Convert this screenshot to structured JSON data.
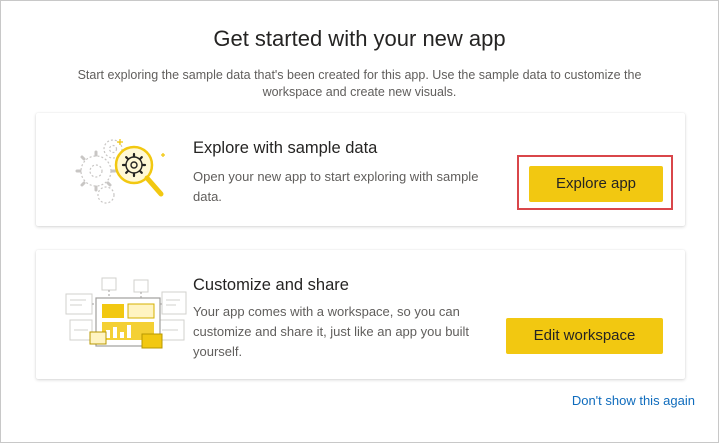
{
  "dialog": {
    "title": "Get started with your new app",
    "subtitle": "Start exploring the sample data that's been created for this app. Use the sample data to customize the workspace and create new visuals."
  },
  "cards": [
    {
      "title": "Explore with sample data",
      "description": "Open your new app to start exploring with sample data.",
      "button_label": "Explore app",
      "illustration_icon": "gears-magnifier-icon"
    },
    {
      "title": "Customize and share",
      "description": "Your app comes with a workspace, so you can customize and share it, just like an app you built yourself.",
      "button_label": "Edit workspace",
      "illustration_icon": "dashboard-visuals-icon"
    }
  ],
  "footer": {
    "dismiss_link": "Don't show this again"
  },
  "colors": {
    "accent": "#f2c811",
    "highlight_border": "#d9464a",
    "link": "#0f6cbd",
    "text_primary": "#252423",
    "text_secondary": "#605e5c"
  }
}
